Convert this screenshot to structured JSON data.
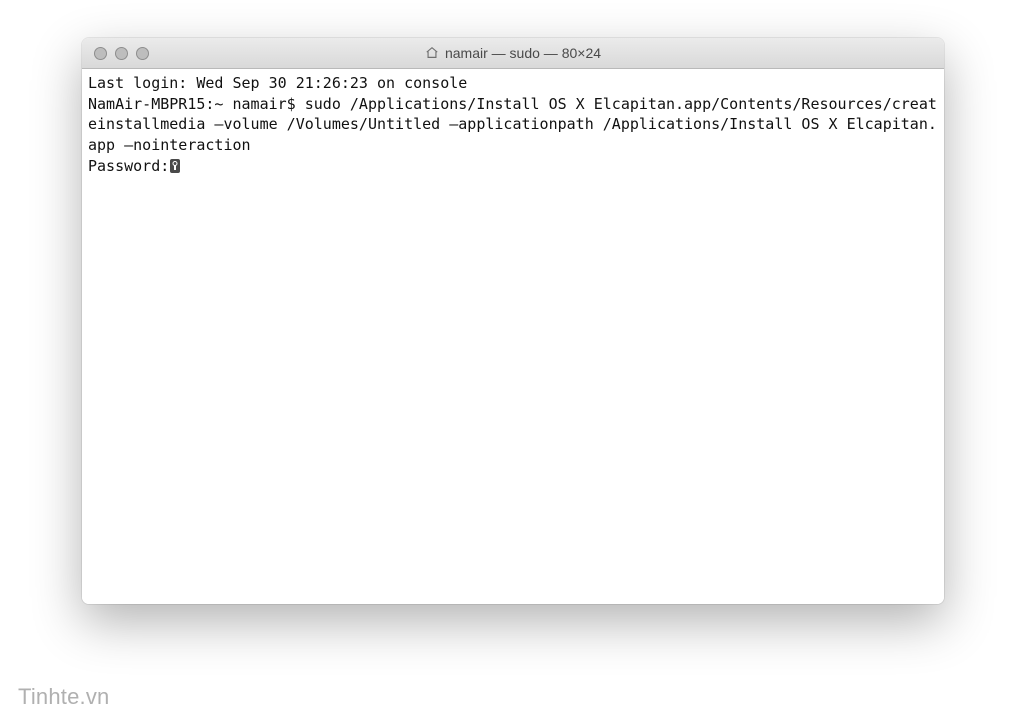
{
  "window": {
    "title": "namair — sudo — 80×24"
  },
  "terminal": {
    "last_login": "Last login: Wed Sep 30 21:26:23 on console",
    "prompt_line": "NamAir-MBPR15:~ namair$ sudo /Applications/Install OS X Elcapitan.app/Contents/Resources/createinstallmedia –volume /Volumes/Untitled –applicationpath /Applications/Install OS X Elcapitan.app –nointeraction",
    "password_prompt": "Password:"
  },
  "watermark": "Tinhte.vn"
}
